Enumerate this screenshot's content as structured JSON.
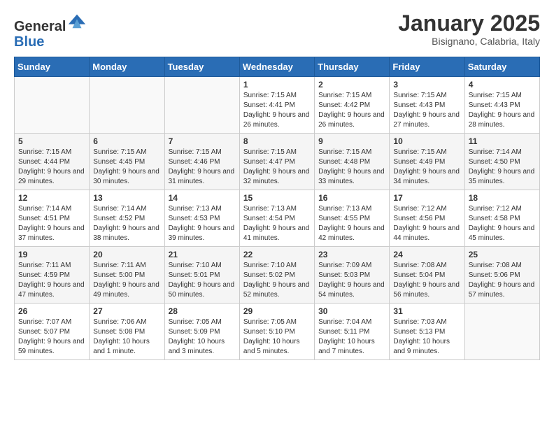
{
  "header": {
    "logo_general": "General",
    "logo_blue": "Blue",
    "month_title": "January 2025",
    "location": "Bisignano, Calabria, Italy"
  },
  "days_of_week": [
    "Sunday",
    "Monday",
    "Tuesday",
    "Wednesday",
    "Thursday",
    "Friday",
    "Saturday"
  ],
  "weeks": [
    [
      {
        "day": "",
        "info": ""
      },
      {
        "day": "",
        "info": ""
      },
      {
        "day": "",
        "info": ""
      },
      {
        "day": "1",
        "info": "Sunrise: 7:15 AM\nSunset: 4:41 PM\nDaylight: 9 hours and 26 minutes."
      },
      {
        "day": "2",
        "info": "Sunrise: 7:15 AM\nSunset: 4:42 PM\nDaylight: 9 hours and 26 minutes."
      },
      {
        "day": "3",
        "info": "Sunrise: 7:15 AM\nSunset: 4:43 PM\nDaylight: 9 hours and 27 minutes."
      },
      {
        "day": "4",
        "info": "Sunrise: 7:15 AM\nSunset: 4:43 PM\nDaylight: 9 hours and 28 minutes."
      }
    ],
    [
      {
        "day": "5",
        "info": "Sunrise: 7:15 AM\nSunset: 4:44 PM\nDaylight: 9 hours and 29 minutes."
      },
      {
        "day": "6",
        "info": "Sunrise: 7:15 AM\nSunset: 4:45 PM\nDaylight: 9 hours and 30 minutes."
      },
      {
        "day": "7",
        "info": "Sunrise: 7:15 AM\nSunset: 4:46 PM\nDaylight: 9 hours and 31 minutes."
      },
      {
        "day": "8",
        "info": "Sunrise: 7:15 AM\nSunset: 4:47 PM\nDaylight: 9 hours and 32 minutes."
      },
      {
        "day": "9",
        "info": "Sunrise: 7:15 AM\nSunset: 4:48 PM\nDaylight: 9 hours and 33 minutes."
      },
      {
        "day": "10",
        "info": "Sunrise: 7:15 AM\nSunset: 4:49 PM\nDaylight: 9 hours and 34 minutes."
      },
      {
        "day": "11",
        "info": "Sunrise: 7:14 AM\nSunset: 4:50 PM\nDaylight: 9 hours and 35 minutes."
      }
    ],
    [
      {
        "day": "12",
        "info": "Sunrise: 7:14 AM\nSunset: 4:51 PM\nDaylight: 9 hours and 37 minutes."
      },
      {
        "day": "13",
        "info": "Sunrise: 7:14 AM\nSunset: 4:52 PM\nDaylight: 9 hours and 38 minutes."
      },
      {
        "day": "14",
        "info": "Sunrise: 7:13 AM\nSunset: 4:53 PM\nDaylight: 9 hours and 39 minutes."
      },
      {
        "day": "15",
        "info": "Sunrise: 7:13 AM\nSunset: 4:54 PM\nDaylight: 9 hours and 41 minutes."
      },
      {
        "day": "16",
        "info": "Sunrise: 7:13 AM\nSunset: 4:55 PM\nDaylight: 9 hours and 42 minutes."
      },
      {
        "day": "17",
        "info": "Sunrise: 7:12 AM\nSunset: 4:56 PM\nDaylight: 9 hours and 44 minutes."
      },
      {
        "day": "18",
        "info": "Sunrise: 7:12 AM\nSunset: 4:58 PM\nDaylight: 9 hours and 45 minutes."
      }
    ],
    [
      {
        "day": "19",
        "info": "Sunrise: 7:11 AM\nSunset: 4:59 PM\nDaylight: 9 hours and 47 minutes."
      },
      {
        "day": "20",
        "info": "Sunrise: 7:11 AM\nSunset: 5:00 PM\nDaylight: 9 hours and 49 minutes."
      },
      {
        "day": "21",
        "info": "Sunrise: 7:10 AM\nSunset: 5:01 PM\nDaylight: 9 hours and 50 minutes."
      },
      {
        "day": "22",
        "info": "Sunrise: 7:10 AM\nSunset: 5:02 PM\nDaylight: 9 hours and 52 minutes."
      },
      {
        "day": "23",
        "info": "Sunrise: 7:09 AM\nSunset: 5:03 PM\nDaylight: 9 hours and 54 minutes."
      },
      {
        "day": "24",
        "info": "Sunrise: 7:08 AM\nSunset: 5:04 PM\nDaylight: 9 hours and 56 minutes."
      },
      {
        "day": "25",
        "info": "Sunrise: 7:08 AM\nSunset: 5:06 PM\nDaylight: 9 hours and 57 minutes."
      }
    ],
    [
      {
        "day": "26",
        "info": "Sunrise: 7:07 AM\nSunset: 5:07 PM\nDaylight: 9 hours and 59 minutes."
      },
      {
        "day": "27",
        "info": "Sunrise: 7:06 AM\nSunset: 5:08 PM\nDaylight: 10 hours and 1 minute."
      },
      {
        "day": "28",
        "info": "Sunrise: 7:05 AM\nSunset: 5:09 PM\nDaylight: 10 hours and 3 minutes."
      },
      {
        "day": "29",
        "info": "Sunrise: 7:05 AM\nSunset: 5:10 PM\nDaylight: 10 hours and 5 minutes."
      },
      {
        "day": "30",
        "info": "Sunrise: 7:04 AM\nSunset: 5:11 PM\nDaylight: 10 hours and 7 minutes."
      },
      {
        "day": "31",
        "info": "Sunrise: 7:03 AM\nSunset: 5:13 PM\nDaylight: 10 hours and 9 minutes."
      },
      {
        "day": "",
        "info": ""
      }
    ]
  ]
}
